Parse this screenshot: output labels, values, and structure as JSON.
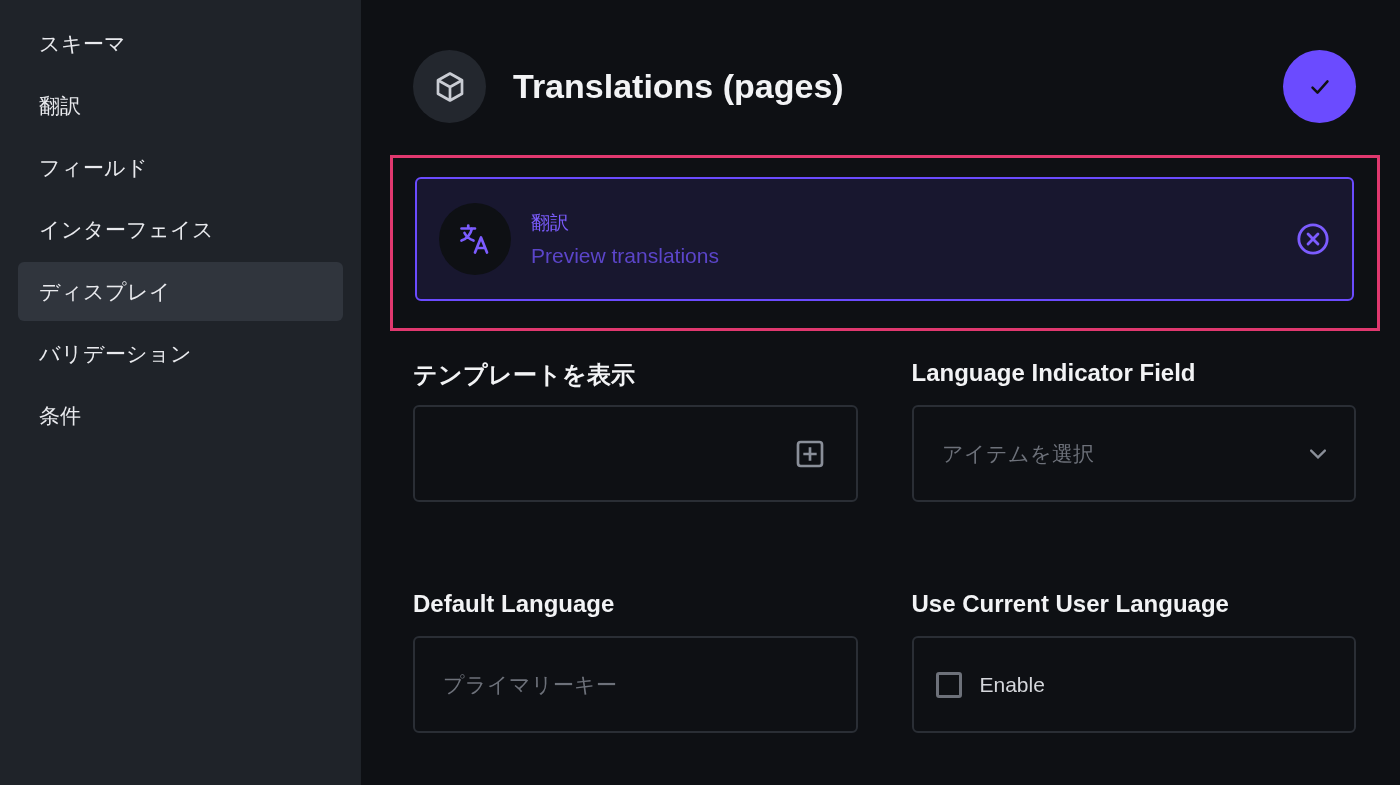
{
  "sidebar": {
    "items": [
      {
        "label": "スキーマ",
        "selected": false
      },
      {
        "label": "翻訳",
        "selected": false
      },
      {
        "label": "フィールド",
        "selected": false
      },
      {
        "label": "インターフェイス",
        "selected": false
      },
      {
        "label": "ディスプレイ",
        "selected": true
      },
      {
        "label": "バリデーション",
        "selected": false
      },
      {
        "label": "条件",
        "selected": false
      }
    ]
  },
  "header": {
    "title": "Translations (pages)"
  },
  "selected_display": {
    "title": "翻訳",
    "subtitle": "Preview translations",
    "highlighted": true
  },
  "fields": [
    {
      "kind": "template",
      "label": "テンプレートを表示"
    },
    {
      "kind": "select",
      "label": "Language Indicator Field",
      "placeholder": "アイテムを選択"
    },
    {
      "kind": "input",
      "label": "Default Language",
      "placeholder": "プライマリーキー"
    },
    {
      "kind": "checkbox",
      "label": "Use Current User Language",
      "option": "Enable",
      "checked": false
    }
  ]
}
